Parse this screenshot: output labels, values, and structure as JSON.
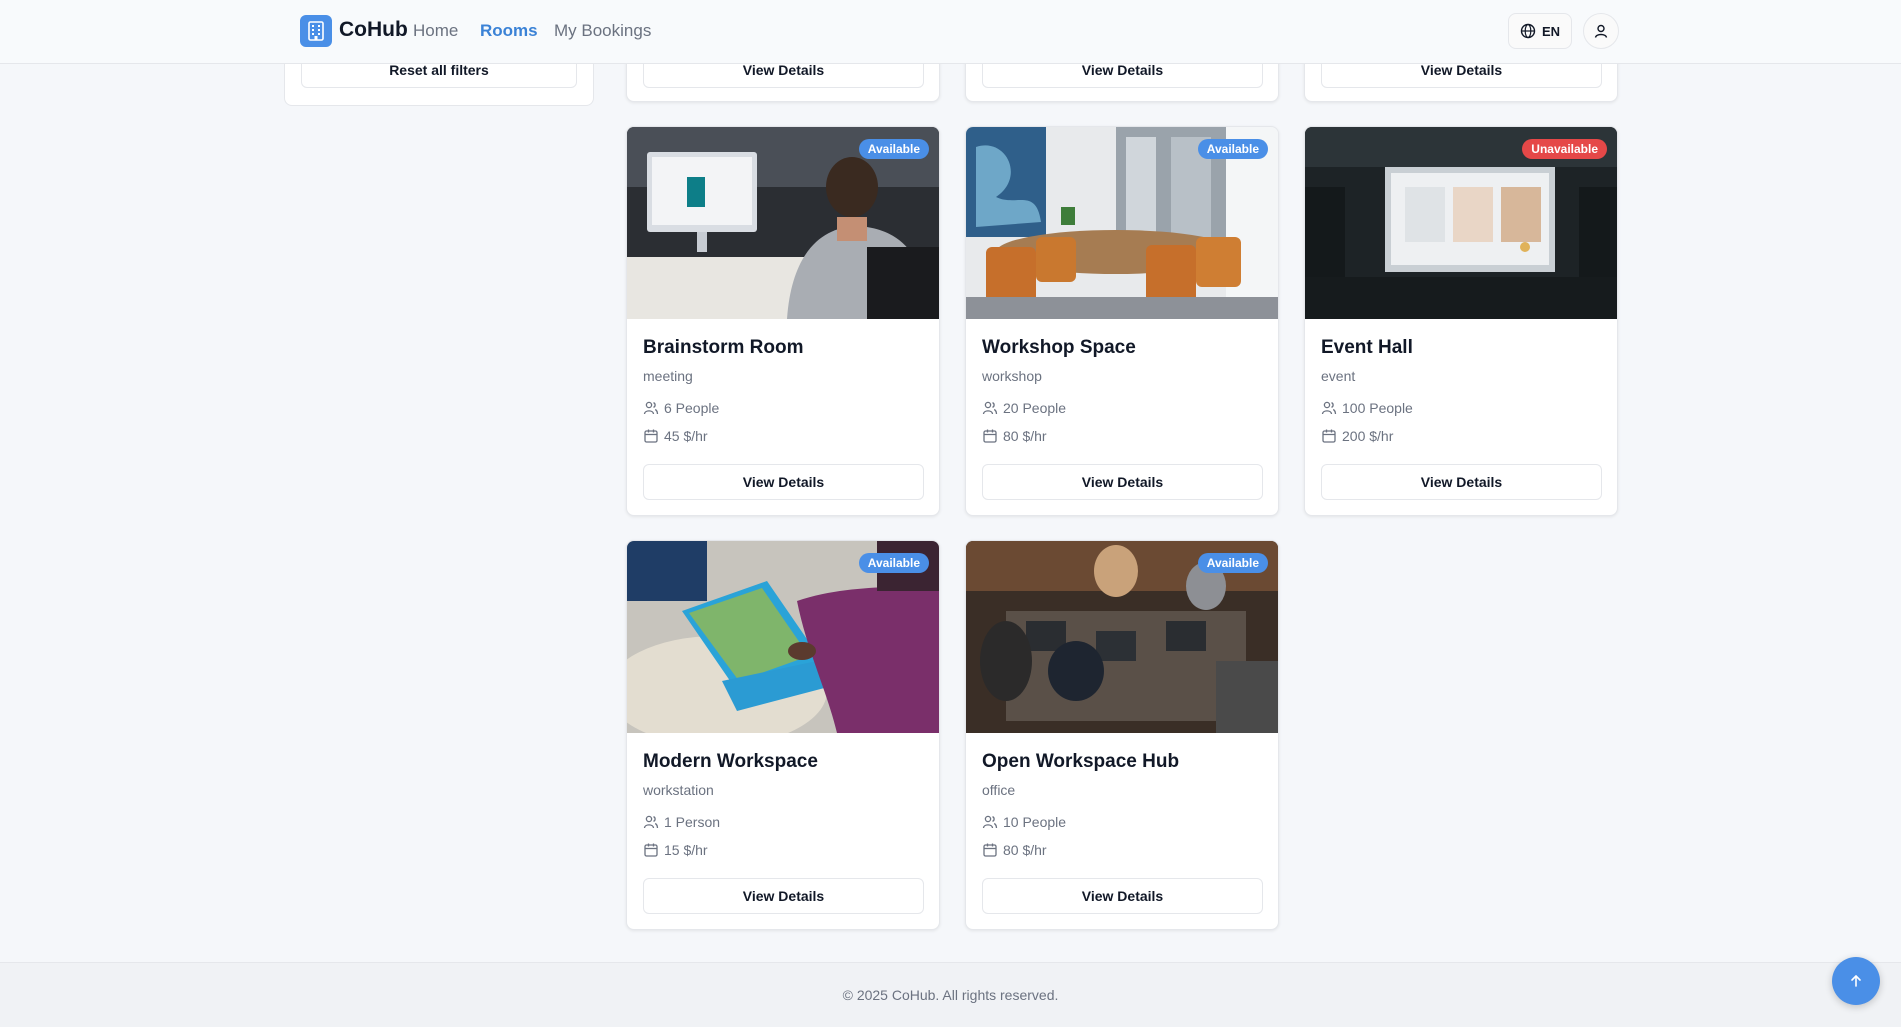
{
  "header": {
    "brand": "CoHub",
    "nav": [
      {
        "label": "Home",
        "active": false
      },
      {
        "label": "Rooms",
        "active": true
      },
      {
        "label": "My Bookings",
        "active": false
      }
    ],
    "language": "EN"
  },
  "sidebar": {
    "reset_label": "Reset all filters"
  },
  "partial_cards": [
    {
      "button": "View Details"
    },
    {
      "button": "View Details"
    },
    {
      "button": "View Details"
    }
  ],
  "rooms": [
    {
      "title": "Brainstorm Room",
      "type": "meeting",
      "capacity": "6 People",
      "price": "45 $/hr",
      "status": "Available",
      "button": "View Details"
    },
    {
      "title": "Workshop Space",
      "type": "workshop",
      "capacity": "20 People",
      "price": "80 $/hr",
      "status": "Available",
      "button": "View Details"
    },
    {
      "title": "Event Hall",
      "type": "event",
      "capacity": "100 People",
      "price": "200 $/hr",
      "status": "Unavailable",
      "button": "View Details"
    },
    {
      "title": "Modern Workspace",
      "type": "workstation",
      "capacity": "1 Person",
      "price": "15 $/hr",
      "status": "Available",
      "button": "View Details"
    },
    {
      "title": "Open Workspace Hub",
      "type": "office",
      "capacity": "10 People",
      "price": "80 $/hr",
      "status": "Available",
      "button": "View Details"
    }
  ],
  "footer": {
    "copyright": "© 2025 CoHub. All rights reserved."
  },
  "colors": {
    "accent": "#4a8fe7",
    "available": "#4a8fe7",
    "unavailable": "#e54848"
  }
}
